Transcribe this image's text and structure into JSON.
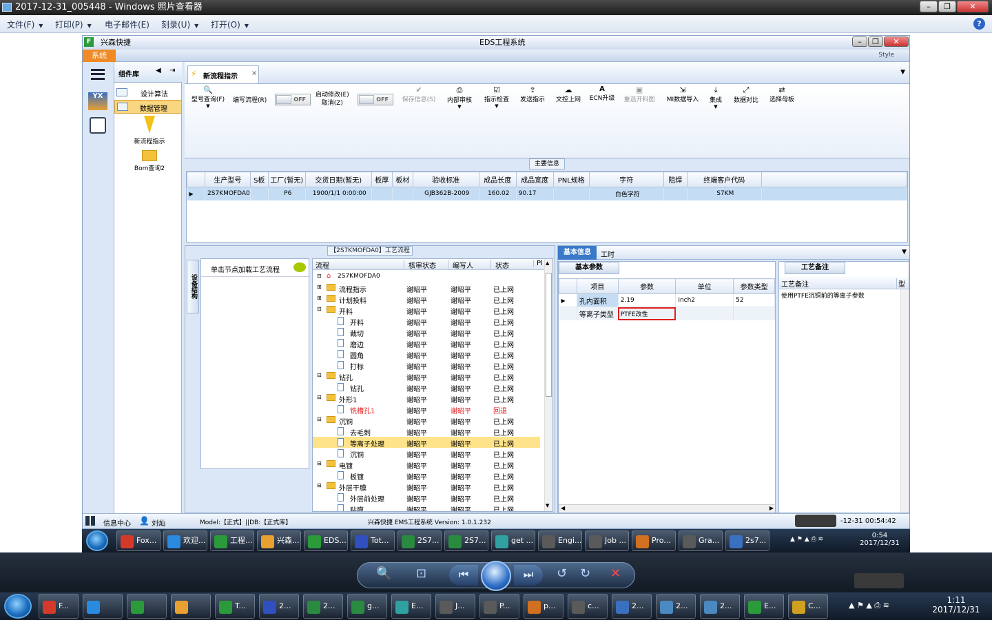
{
  "viewer": {
    "title": "2017-12-31_005448 - Windows 照片查看器",
    "menu": [
      "文件(F)",
      "打印(P)",
      "电子邮件(E)",
      "刻录(U)",
      "打开(O)"
    ],
    "help": "?"
  },
  "eds": {
    "brand": "兴森快捷",
    "title": "EDS工程系统",
    "system_tab": "系统",
    "style_label": "Style",
    "component_lib": "组件库",
    "left_items": [
      "设计算法",
      "数据管理"
    ],
    "comp_items": [
      "新流程指示",
      "Bom查询2"
    ],
    "doc_tab": "新流程指示",
    "toolbar": {
      "model_query": "型号查询(F)",
      "edit_flow": "编写流程(R)",
      "toggle1": "OFF",
      "auto_modify": "启动修改(E)",
      "cancel": "取消(Z)",
      "toggle2": "OFF",
      "save_info": "保存信息(S)",
      "internal_review": "内部审核",
      "instr_check": "指示检查",
      "send_instr": "发送指示",
      "doc_upload": "文控上网",
      "ecn_upgrade": "ECN升级",
      "reselect_img": "重选开料图",
      "mi_import": "MI数据导入",
      "integrate": "集成",
      "data_compare": "数据对比",
      "select_board": "选择母板"
    },
    "main_info": "主要信息",
    "main_table": {
      "headers": [
        "生产型号",
        "S板",
        "工厂(暂无)",
        "交货日期(暂无)",
        "板厚",
        "板材",
        "验收标准",
        "成品长度",
        "成品宽度",
        "PNL规格",
        "字符",
        "阻焊",
        "终端客户代码"
      ],
      "row": [
        "2S7KMOFDA0",
        "",
        "P6",
        "1900/1/1 0:00:00",
        "",
        "",
        "GJB362B-2009",
        "160.02",
        "90.17",
        "",
        "白色字符",
        "",
        "S7KM"
      ]
    },
    "flow_panel_title": "【2S7KMOFDA0】工艺流程",
    "side_vertical": "设备结构",
    "click_hint": "单击节点加载工艺流程",
    "tree_headers": [
      "流程",
      "核审状态",
      "编写人",
      "状态",
      "Pl"
    ],
    "tree_root": "2S7KMOFDA0",
    "tree": [
      {
        "name": "流程指示",
        "type": "folder",
        "level": 1,
        "review": "谢昭平",
        "author": "谢昭平",
        "status": "已上网"
      },
      {
        "name": "计划投料",
        "type": "folder",
        "level": 1,
        "review": "谢昭平",
        "author": "谢昭平",
        "status": "已上网"
      },
      {
        "name": "开料",
        "type": "folder",
        "level": 1,
        "review": "谢昭平",
        "author": "谢昭平",
        "status": "已上网"
      },
      {
        "name": "开料",
        "type": "doc",
        "level": 2,
        "review": "谢昭平",
        "author": "谢昭平",
        "status": "已上网"
      },
      {
        "name": "裁切",
        "type": "doc",
        "level": 2,
        "review": "谢昭平",
        "author": "谢昭平",
        "status": "已上网"
      },
      {
        "name": "磨边",
        "type": "doc",
        "level": 2,
        "review": "谢昭平",
        "author": "谢昭平",
        "status": "已上网"
      },
      {
        "name": "圆角",
        "type": "doc",
        "level": 2,
        "review": "谢昭平",
        "author": "谢昭平",
        "status": "已上网"
      },
      {
        "name": "打标",
        "type": "doc",
        "level": 2,
        "review": "谢昭平",
        "author": "谢昭平",
        "status": "已上网"
      },
      {
        "name": "钻孔",
        "type": "folder",
        "level": 1,
        "review": "谢昭平",
        "author": "谢昭平",
        "status": "已上网"
      },
      {
        "name": "钻孔",
        "type": "doc",
        "level": 2,
        "review": "谢昭平",
        "author": "谢昭平",
        "status": "已上网"
      },
      {
        "name": "外形1",
        "type": "folder",
        "level": 1,
        "review": "谢昭平",
        "author": "谢昭平",
        "status": "已上网"
      },
      {
        "name": "铣槽孔1",
        "type": "doc",
        "level": 2,
        "review": "谢昭平",
        "author": "谢昭平",
        "status": "回退",
        "red": true
      },
      {
        "name": "沉铜",
        "type": "folder",
        "level": 1,
        "review": "谢昭平",
        "author": "谢昭平",
        "status": "已上网"
      },
      {
        "name": "去毛刺",
        "type": "doc",
        "level": 2,
        "review": "谢昭平",
        "author": "谢昭平",
        "status": "已上网"
      },
      {
        "name": "等离子处理",
        "type": "doc",
        "level": 2,
        "review": "谢昭平",
        "author": "谢昭平",
        "status": "已上网",
        "selected": true
      },
      {
        "name": "沉铜",
        "type": "doc",
        "level": 2,
        "review": "谢昭平",
        "author": "谢昭平",
        "status": "已上网"
      },
      {
        "name": "电镀",
        "type": "folder",
        "level": 1,
        "review": "谢昭平",
        "author": "谢昭平",
        "status": "已上网"
      },
      {
        "name": "板镀",
        "type": "doc",
        "level": 2,
        "review": "谢昭平",
        "author": "谢昭平",
        "status": "已上网"
      },
      {
        "name": "外层干膜",
        "type": "folder",
        "level": 1,
        "review": "谢昭平",
        "author": "谢昭平",
        "status": "已上网"
      },
      {
        "name": "外层前处理",
        "type": "doc",
        "level": 2,
        "review": "谢昭平",
        "author": "谢昭平",
        "status": "已上网"
      },
      {
        "name": "贴膜",
        "type": "doc",
        "level": 2,
        "review": "谢昭平",
        "author": "谢昭平",
        "status": "已上网"
      },
      {
        "name": "曝光",
        "type": "doc",
        "level": 2,
        "review": "谢昭平",
        "author": "谢昭平",
        "status": "已上网"
      },
      {
        "name": "显影",
        "type": "doc",
        "level": 2,
        "review": "谢昭平",
        "author": "谢昭平",
        "status": "已上网"
      }
    ],
    "info_tabs": [
      "基本信息",
      "工时"
    ],
    "basic_params_tab": "基本参数",
    "param_headers": [
      "项目",
      "参数",
      "单位",
      "参数类型"
    ],
    "params": [
      {
        "item": "孔内面积",
        "value": "2.19",
        "unit": "inch2",
        "type": "52"
      },
      {
        "item": "等离子类型",
        "value": "PTFE改性",
        "unit": "",
        "type": ""
      }
    ],
    "remark_tab": "工艺备注",
    "remark_headers": [
      "工艺备注",
      "型"
    ],
    "remark_text": "使用PTFE沉铜前的等离子参数",
    "status": {
      "info_center": "信息中心",
      "user": "刘灿",
      "model": "Model:【正式】||DB:【正式库】",
      "version": "兴森快捷 EMS工程系统 Version: 1.0.1.232",
      "time": "-12-31 00:54:42"
    }
  },
  "inner_taskbar": {
    "items": [
      "Fox...",
      "欢迎...",
      "工程...",
      "兴森...",
      "EDS...",
      "Tot...",
      "2S7...",
      "2S7...",
      "get ...",
      "Engi...",
      "Job ...",
      "Pro...",
      "Gra...",
      "2s7..."
    ],
    "clock_time": "0:54",
    "clock_date": "2017/12/31"
  },
  "outer_taskbar": {
    "items": [
      "F...",
      "",
      "",
      "",
      "T...",
      "2...",
      "2...",
      "g...",
      "E...",
      "J...",
      "P...",
      "p...",
      "c...",
      "2...",
      "2...",
      "2...",
      "E...",
      "C..."
    ],
    "clock_time": "1:11",
    "clock_date": "2017/12/31"
  },
  "colors": {
    "accent_orange": "#f08a24",
    "selection_yellow": "#ffe38a",
    "row_blue": "#c4dcf4",
    "highlight_red": "#e02020"
  }
}
